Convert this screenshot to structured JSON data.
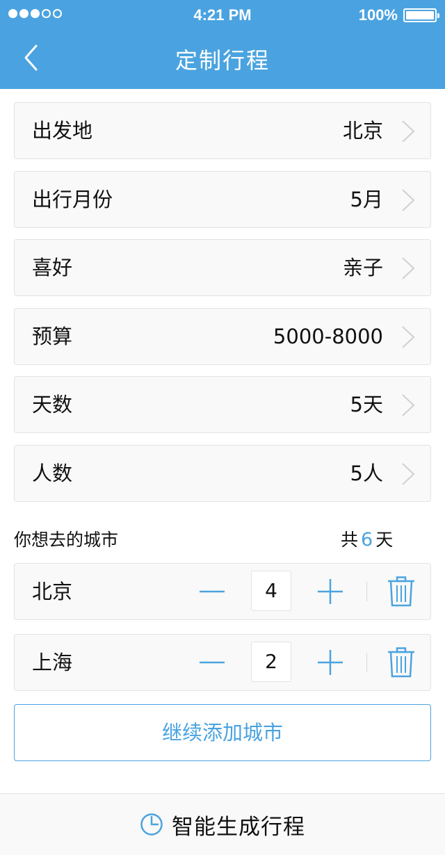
{
  "status_bar": {
    "time": "4:21 PM",
    "battery_percent": "100%",
    "signal_bars_on": 3,
    "signal_bars_total": 5
  },
  "nav": {
    "title": "定制行程",
    "back_icon": "chevron-left-icon"
  },
  "form": {
    "rows": [
      {
        "label": "出发地",
        "value": "北京"
      },
      {
        "label": "出行月份",
        "value": "5月"
      },
      {
        "label": "喜好",
        "value": "亲子"
      },
      {
        "label": "预算",
        "value": "5000-8000"
      },
      {
        "label": "天数",
        "value": "5天"
      },
      {
        "label": "人数",
        "value": "5人"
      }
    ]
  },
  "cities": {
    "section_label": "你想去的城市",
    "total_prefix": "共",
    "total_days": "6",
    "total_suffix": "天",
    "items": [
      {
        "name": "北京",
        "days": "4"
      },
      {
        "name": "上海",
        "days": "2"
      }
    ]
  },
  "add_city_label": "继续添加城市",
  "footer": {
    "label": "智能生成行程",
    "icon": "clock-icon"
  },
  "colors": {
    "accent": "#4aa3e0",
    "row_bg": "#f9f9f9",
    "border": "#e2e2e2"
  }
}
